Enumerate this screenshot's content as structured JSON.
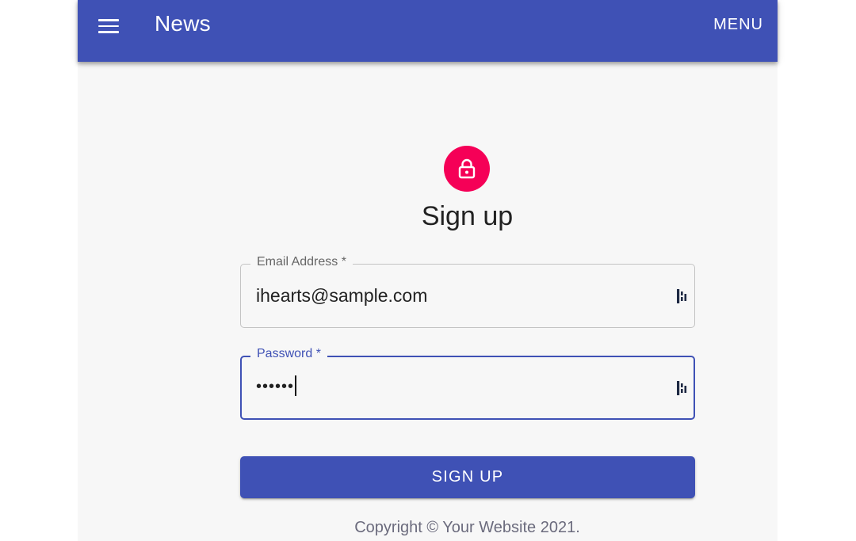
{
  "appbar": {
    "title": "News",
    "menu_label": "MENU"
  },
  "form": {
    "heading": "Sign up",
    "email": {
      "label": "Email Address *",
      "value": "ihearts@sample.com"
    },
    "password": {
      "label": "Password *",
      "masked_value": "••••••"
    },
    "submit_label": "SIGN UP"
  },
  "footer": {
    "copyright": "Copyright © Your Website 2021."
  },
  "colors": {
    "primary": "#3f51b5",
    "accent": "#f50057",
    "background": "#f7f7f7"
  },
  "icons": {
    "menu": "hamburger-menu-icon",
    "avatar": "lock-icon",
    "field_extension": "password-manager-icon"
  }
}
